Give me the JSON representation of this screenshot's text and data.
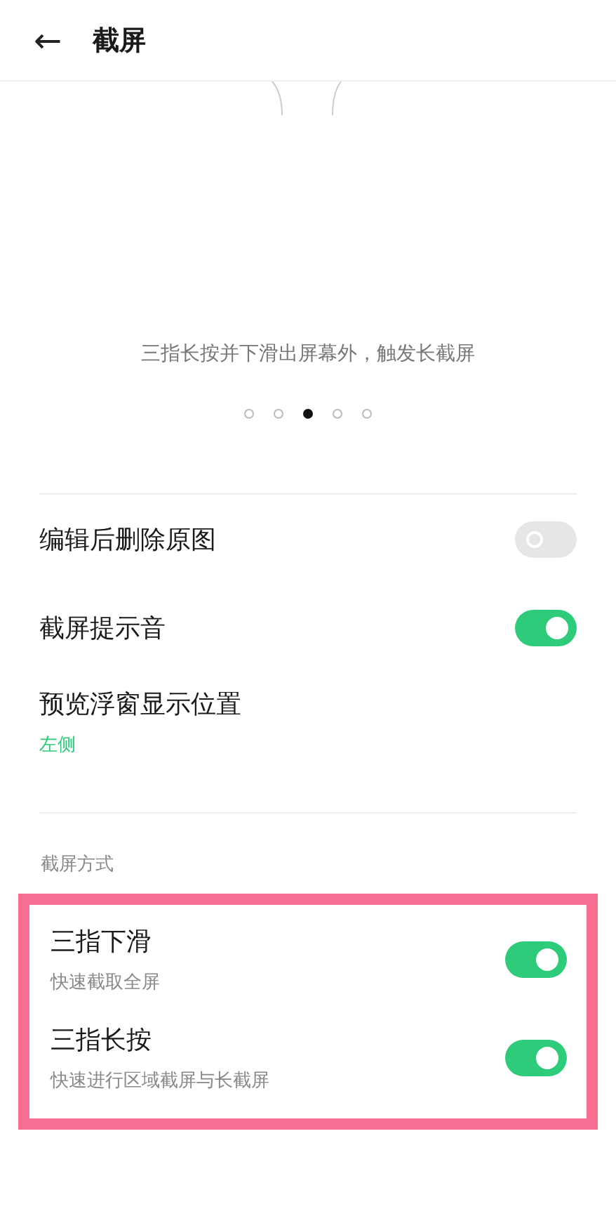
{
  "header": {
    "back_glyph": "←",
    "title": "截屏"
  },
  "illustration": {
    "caption": "三指长按并下滑出屏幕外，触发长截屏"
  },
  "pager": [
    {
      "selected": false
    },
    {
      "selected": false
    },
    {
      "selected": true
    },
    {
      "selected": false
    },
    {
      "selected": false
    }
  ],
  "settings": [
    {
      "kind": "toggle",
      "label": "编辑后删除原图",
      "on": false
    },
    {
      "kind": "toggle",
      "label": "截屏提示音",
      "on": true
    },
    {
      "kind": "choice",
      "label": "预览浮窗显示位置",
      "value": "左侧"
    }
  ],
  "section": {
    "title": "截屏方式",
    "items": [
      {
        "label": "三指下滑",
        "description": "快速截取全屏",
        "on": true
      },
      {
        "label": "三指长按",
        "description": "快速进行区域截屏与长截屏",
        "on": true
      }
    ]
  }
}
